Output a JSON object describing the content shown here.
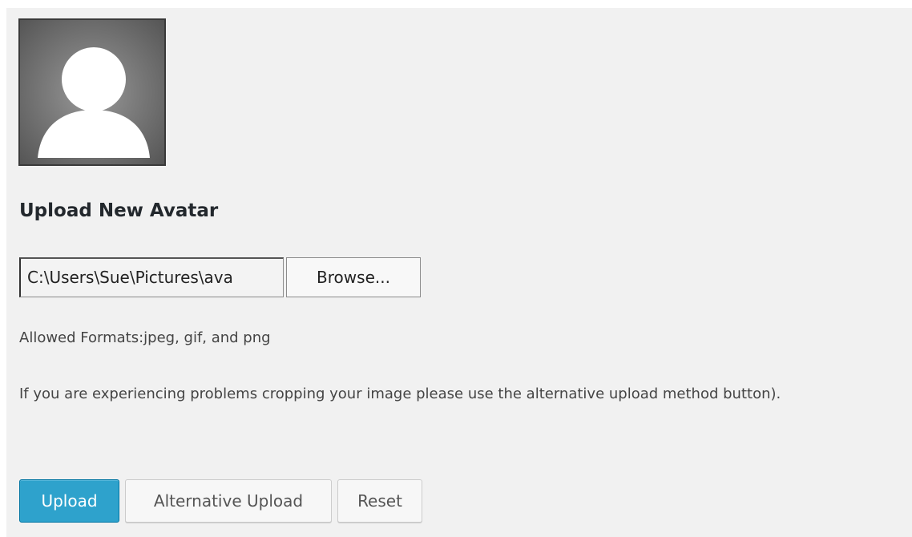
{
  "avatar": {
    "icon": "user-silhouette-icon"
  },
  "upload": {
    "heading": "Upload New Avatar",
    "file_path_value": "C:\\Users\\Sue\\Pictures\\ava",
    "browse_label": "Browse...",
    "allowed_formats": "Allowed Formats:jpeg, gif, and png",
    "note": "If you are experiencing problems cropping your image please use the alternative upload method button)."
  },
  "actions": {
    "upload_label": "Upload",
    "alternative_label": "Alternative Upload",
    "reset_label": "Reset"
  },
  "colors": {
    "primary": "#2ea2cc",
    "primary_border": "#0074a2",
    "panel_bg": "#f1f1f1"
  }
}
